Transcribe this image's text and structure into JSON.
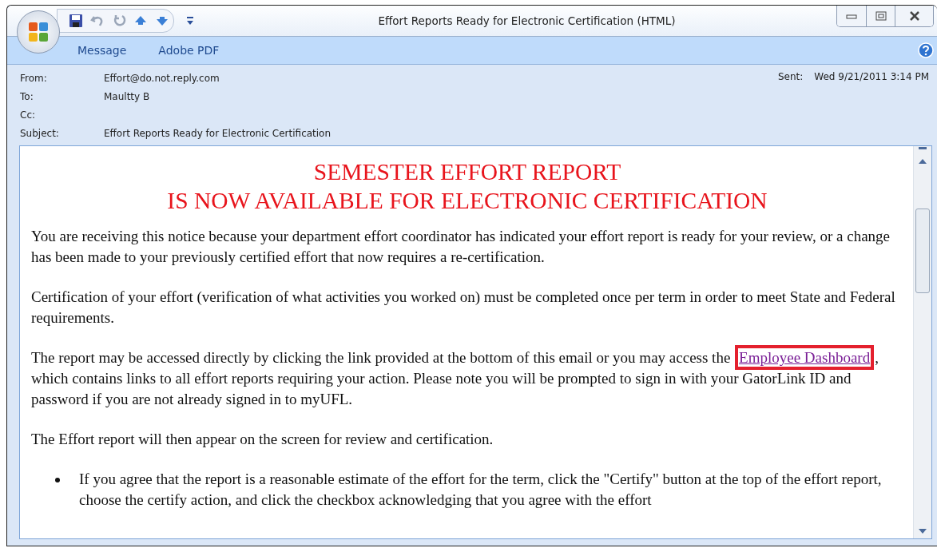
{
  "window": {
    "title": "Effort Reports Ready for Electronic Certification  (HTML)"
  },
  "quick_access": [
    {
      "kind": "save"
    },
    {
      "kind": "undo"
    },
    {
      "kind": "redo"
    },
    {
      "kind": "up"
    },
    {
      "kind": "down"
    },
    {
      "kind": "more"
    }
  ],
  "ribbon_tabs": [
    "Message",
    "Adobe PDF"
  ],
  "header": {
    "fields": [
      {
        "label": "From:",
        "value": "Effort@do.not.reply.com"
      },
      {
        "label": "To:",
        "value": "Maultty B"
      },
      {
        "label": "Cc:"
      },
      {
        "label": "Subject:",
        "value": "Effort Reports Ready for Electronic Certification"
      }
    ],
    "sent_label": "Sent:",
    "sent_value": "Wed 9/21/2011 3:14 PM"
  },
  "body": {
    "heading": [
      "SEMESTER EFFORT REPORT",
      "IS NOW AVAILABLE FOR ELECTRONIC CERTIFICATION"
    ],
    "paragraphs": [
      {
        "kind": "text",
        "text": "You are receiving this notice because your department effort coordinator has indicated your effort report is ready for your review, or a change has been made to your previously certified effort that now requires a re-certification."
      },
      {
        "kind": "text",
        "text": "Certification of your effort (verification of what activities you worked on) must be completed once per term in order to meet State and Federal requirements."
      },
      {
        "kind": "link",
        "before": "The report may be accessed directly by clicking the link provided at the bottom of this email or you may access the",
        "link": "Employee Dashboard",
        "highlighted": true,
        "after": ", which contains links to all effort reports requiring your action. Please note you will be prompted to sign in with your GatorLink ID and password if you are not already signed in to myUFL."
      },
      {
        "kind": "text",
        "text": "The Effort report will then appear on the screen for review and certification."
      },
      {
        "kind": "bullet",
        "text": "If you agree that the report is a reasonable estimate of the effort for the term, click the \"Certify\" button at the top of the effort report, choose the certify action, and click the checkbox acknowledging that you agree with the effort"
      }
    ]
  }
}
